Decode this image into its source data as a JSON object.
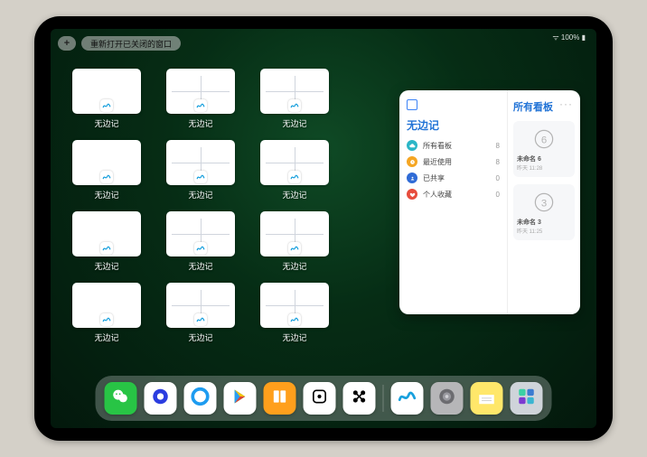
{
  "status": {
    "battery": "100%"
  },
  "topbar": {
    "plus": "+",
    "pill_label": "重新打开已关闭的窗口"
  },
  "app_name": "无边记",
  "thumbs": [
    {
      "label": "无边记",
      "variant": "blank"
    },
    {
      "label": "无边记",
      "variant": "grid"
    },
    {
      "label": "无边记",
      "variant": "grid"
    },
    {
      "label": "无边记",
      "variant": "blank"
    },
    {
      "label": "无边记",
      "variant": "grid"
    },
    {
      "label": "无边记",
      "variant": "grid"
    },
    {
      "label": "无边记",
      "variant": "blank"
    },
    {
      "label": "无边记",
      "variant": "grid"
    },
    {
      "label": "无边记",
      "variant": "grid"
    },
    {
      "label": "无边记",
      "variant": "blank"
    },
    {
      "label": "无边记",
      "variant": "grid"
    },
    {
      "label": "无边记",
      "variant": "grid"
    }
  ],
  "panel": {
    "title": "无边记",
    "right_title": "所有看板",
    "categories": [
      {
        "icon": "cloud",
        "color": "#2bb6c7",
        "name": "所有看板",
        "count": "8"
      },
      {
        "icon": "clock",
        "color": "#f5a623",
        "name": "最近使用",
        "count": "8"
      },
      {
        "icon": "people",
        "color": "#2f6bd6",
        "name": "已共享",
        "count": "0"
      },
      {
        "icon": "heart",
        "color": "#e74c3c",
        "name": "个人收藏",
        "count": "0"
      }
    ],
    "boards": [
      {
        "title": "未命名 6",
        "sub": "昨天 11:28",
        "digit": "6"
      },
      {
        "title": "未命名 3",
        "sub": "昨天 11:25",
        "digit": "3"
      }
    ]
  },
  "dock": {
    "apps": [
      {
        "name": "wechat",
        "bg": "#28c445"
      },
      {
        "name": "quark",
        "bg": "#ffffff"
      },
      {
        "name": "qqbrowser",
        "bg": "#ffffff"
      },
      {
        "name": "play",
        "bg": "#ffffff"
      },
      {
        "name": "books",
        "bg": "#ff9f1c"
      },
      {
        "name": "dice",
        "bg": "#ffffff"
      },
      {
        "name": "connect",
        "bg": "#ffffff"
      },
      {
        "name": "freeform",
        "bg": "#ffffff"
      },
      {
        "name": "settings",
        "bg": "#b6b6b8"
      },
      {
        "name": "notes",
        "bg": "#ffe76a"
      },
      {
        "name": "folder",
        "bg": "#cfd4da"
      }
    ]
  }
}
